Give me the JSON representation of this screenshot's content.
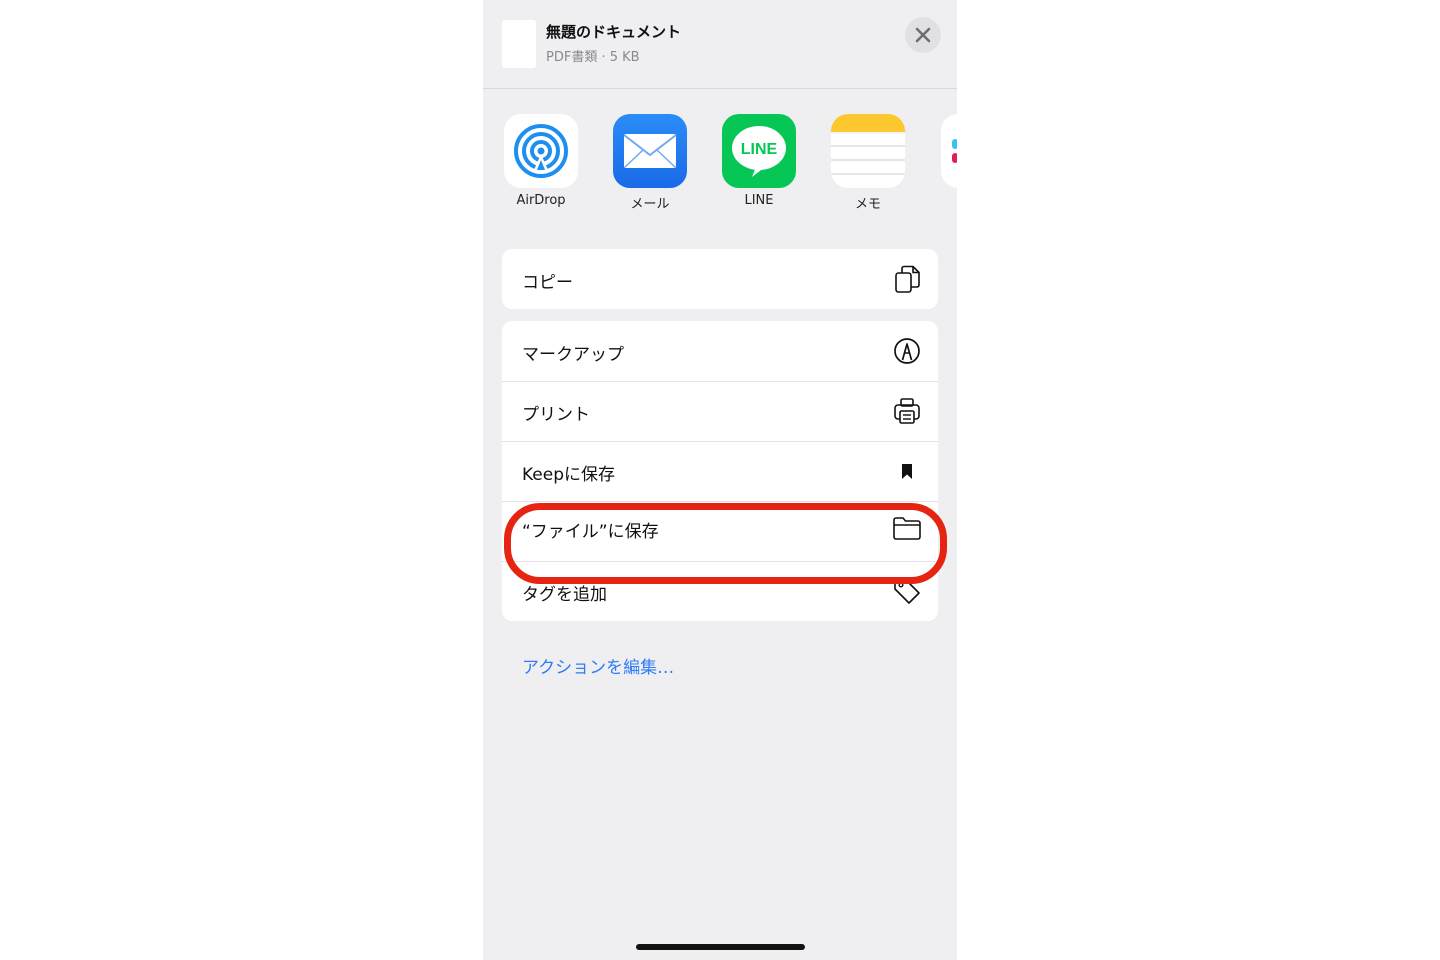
{
  "document": {
    "title": "無題のドキュメント",
    "subtitle": "PDF書類 · 5 KB"
  },
  "apps": [
    {
      "label": "AirDrop",
      "icon": "airdrop-icon"
    },
    {
      "label": "メール",
      "icon": "mail-icon"
    },
    {
      "label": "LINE",
      "icon": "line-icon",
      "icon_text": "LINE"
    },
    {
      "label": "メモ",
      "icon": "notes-icon"
    }
  ],
  "actions": {
    "copy": {
      "label": "コピー",
      "icon": "copy-icon"
    },
    "markup": {
      "label": "マークアップ",
      "icon": "markup-icon"
    },
    "print": {
      "label": "プリント",
      "icon": "printer-icon"
    },
    "keep": {
      "label": "Keepに保存",
      "icon": "bookmark-icon"
    },
    "files": {
      "label": "“ファイル”に保存",
      "icon": "folder-icon"
    },
    "tag": {
      "label": "タグを追加",
      "icon": "tag-icon"
    }
  },
  "edit_actions": "アクションを編集…",
  "colors": {
    "accent": "#2f7cf6",
    "highlight": "#e52411",
    "line_green": "#06c755"
  }
}
